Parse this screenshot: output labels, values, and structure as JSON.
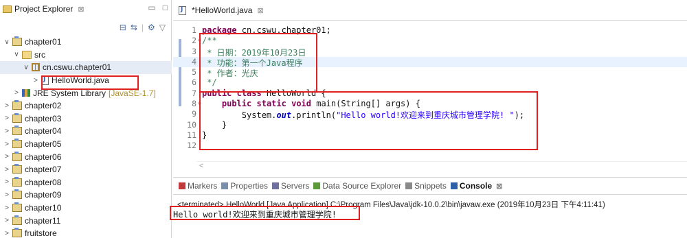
{
  "explorer": {
    "title": "Project Explorer",
    "close": "⊠",
    "tree": [
      {
        "label": "chapter01",
        "level": 0,
        "twisty": "∨",
        "icon": "project"
      },
      {
        "label": "src",
        "level": 1,
        "twisty": "∨",
        "icon": "folder"
      },
      {
        "label": "cn.cswu.chapter01",
        "level": 2,
        "twisty": "∨",
        "icon": "package",
        "selected": true
      },
      {
        "label": "HelloWorld.java",
        "level": 3,
        "twisty": ">",
        "icon": "java"
      },
      {
        "label": "JRE System Library",
        "suffix": "[JavaSE-1.7]",
        "level": 1,
        "twisty": ">",
        "icon": "library"
      },
      {
        "label": "chapter02",
        "level": 0,
        "twisty": ">",
        "icon": "project"
      },
      {
        "label": "chapter03",
        "level": 0,
        "twisty": ">",
        "icon": "project"
      },
      {
        "label": "chapter04",
        "level": 0,
        "twisty": ">",
        "icon": "project"
      },
      {
        "label": "chapter05",
        "level": 0,
        "twisty": ">",
        "icon": "project"
      },
      {
        "label": "chapter06",
        "level": 0,
        "twisty": ">",
        "icon": "project"
      },
      {
        "label": "chapter07",
        "level": 0,
        "twisty": ">",
        "icon": "project"
      },
      {
        "label": "chapter08",
        "level": 0,
        "twisty": ">",
        "icon": "project"
      },
      {
        "label": "chapter09",
        "level": 0,
        "twisty": ">",
        "icon": "project"
      },
      {
        "label": "chapter10",
        "level": 0,
        "twisty": ">",
        "icon": "project"
      },
      {
        "label": "chapter11",
        "level": 0,
        "twisty": ">",
        "icon": "project"
      },
      {
        "label": "fruitstore",
        "level": 0,
        "twisty": ">",
        "icon": "project"
      }
    ]
  },
  "editor": {
    "tab_title": "*HelloWorld.java",
    "close": "⊠",
    "lines": [
      {
        "n": "1",
        "segs": [
          {
            "t": "package",
            "c": "kw"
          },
          {
            "t": " cn.cswu.chapter01;"
          }
        ]
      },
      {
        "n": "2",
        "fold": "⊖",
        "segs": [
          {
            "t": "/**",
            "c": "cmt"
          }
        ]
      },
      {
        "n": "3",
        "segs": [
          {
            "t": " * 日期：2019年10月23日",
            "c": "cmt"
          }
        ]
      },
      {
        "n": "4",
        "hl": true,
        "segs": [
          {
            "t": " * 功能：第一个Java程序",
            "c": "cmt"
          }
        ]
      },
      {
        "n": "5",
        "segs": [
          {
            "t": " * 作者：光庆",
            "c": "cmt"
          }
        ]
      },
      {
        "n": "6",
        "segs": [
          {
            "t": " */",
            "c": "cmt"
          }
        ]
      },
      {
        "n": "7",
        "segs": [
          {
            "t": "public",
            "c": "kw"
          },
          {
            "t": " "
          },
          {
            "t": "class",
            "c": "kw"
          },
          {
            "t": " HelloWorld {"
          }
        ]
      },
      {
        "n": "8",
        "fold": "⊖",
        "segs": [
          {
            "t": "    "
          },
          {
            "t": "public",
            "c": "kw"
          },
          {
            "t": " "
          },
          {
            "t": "static",
            "c": "kw"
          },
          {
            "t": " "
          },
          {
            "t": "void",
            "c": "kw"
          },
          {
            "t": " main(String[] args) {"
          }
        ]
      },
      {
        "n": "9",
        "segs": [
          {
            "t": "        System."
          },
          {
            "t": "out",
            "c": "fld"
          },
          {
            "t": ".println("
          },
          {
            "t": "\"Hello world!欢迎来到重庆城市管理学院! \"",
            "c": "str"
          },
          {
            "t": ");"
          }
        ]
      },
      {
        "n": "10",
        "segs": [
          {
            "t": "    }"
          }
        ]
      },
      {
        "n": "11",
        "segs": [
          {
            "t": "}"
          }
        ]
      },
      {
        "n": "12",
        "segs": [
          {
            "t": ""
          }
        ]
      }
    ]
  },
  "console": {
    "tabs": [
      {
        "label": "Markers",
        "color": "#c23b3b"
      },
      {
        "label": "Properties",
        "color": "#7b8fa8"
      },
      {
        "label": "Servers",
        "color": "#6f6f9f"
      },
      {
        "label": "Data Source Explorer",
        "color": "#5b9a3b"
      },
      {
        "label": "Snippets",
        "color": "#8a8a8a"
      },
      {
        "label": "Console",
        "color": "#2f5fa8",
        "active": true
      }
    ],
    "close": "⊠",
    "terminated": "<terminated> HelloWorld [Java Application] C:\\Program Files\\Java\\jdk-10.0.2\\bin\\javaw.exe (2019年10月23日 下午4:11:41)",
    "output": "Hello world!欢迎来到重庆城市管理学院!"
  },
  "colors": {
    "accent": "#e02020",
    "keyword": "#7f0055",
    "comment": "#3f7f5f",
    "string": "#2a00ff"
  }
}
